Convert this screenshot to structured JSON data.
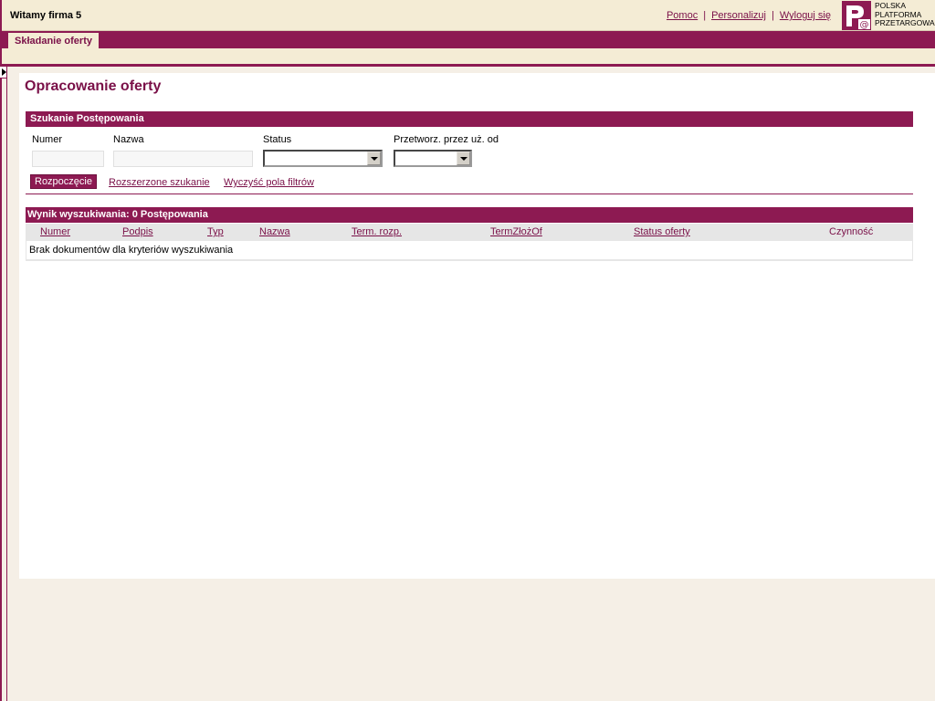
{
  "header": {
    "welcome": "Witamy firma 5",
    "links": {
      "help": "Pomoc",
      "personalize": "Personalizuj",
      "logout": "Wyloguj się"
    },
    "separator": "|",
    "logo": {
      "line1": "POLSKA",
      "line2": "PLATFORMA",
      "line3": "PRZETARGOWA"
    }
  },
  "nav": {
    "tab_label": "Składanie oferty"
  },
  "page": {
    "title": "Opracowanie oferty"
  },
  "search": {
    "section_title": "Szukanie Postępowania",
    "fields": {
      "numer_label": "Numer",
      "nazwa_label": "Nazwa",
      "status_label": "Status",
      "przetworz_label": "Przetworz. przez uż. od",
      "numer_value": "",
      "nazwa_value": "",
      "status_value": "",
      "przetworz_value": ""
    },
    "start_button": "Rozpoczęcie",
    "advanced_link": "Rozszerzone szukanie",
    "clear_link": "Wyczyść pola filtrów"
  },
  "results": {
    "section_title": "Wynik wyszukiwania:  0 Postępowania",
    "columns": [
      "Numer",
      "Podpis",
      "Typ",
      "Nazwa",
      "Term. rozp.",
      "TermZłożOf",
      "Status oferty",
      "Czynność"
    ],
    "empty_message": "Brak dokumentów dla kryteriów wyszukiwania"
  },
  "colors": {
    "accent": "#8d1a52",
    "header_bg": "#f4ecd5",
    "page_bg": "#f5efe6",
    "link": "#7a1048"
  }
}
